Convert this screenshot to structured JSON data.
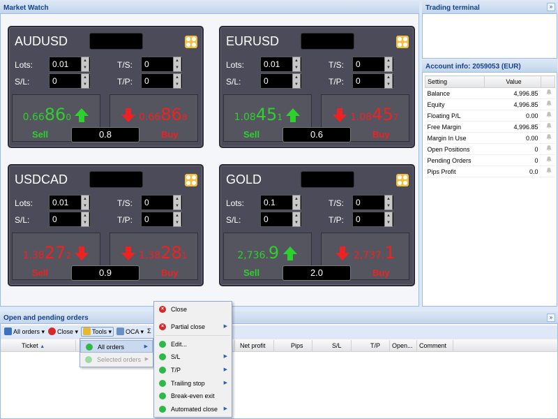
{
  "market_watch": {
    "title": "Market Watch",
    "cards": [
      {
        "symbol": "AUDUSD",
        "lots": "0.01",
        "ts": "0",
        "sl": "0",
        "tp": "0",
        "sell": {
          "pre": "0.66",
          "big": "86",
          "sm": "0",
          "dir": "up"
        },
        "buy": {
          "pre": "0.66",
          "big": "86",
          "sm": "8",
          "dir": "down"
        },
        "spread": "0.8",
        "sell_label": "Sell",
        "buy_label": "Buy",
        "label_color": "green"
      },
      {
        "symbol": "EURUSD",
        "lots": "0.01",
        "ts": "0",
        "sl": "0",
        "tp": "0",
        "sell": {
          "pre": "1.08",
          "big": "45",
          "sm": "1",
          "dir": "up"
        },
        "buy": {
          "pre": "1.08",
          "big": "45",
          "sm": "7",
          "dir": "down"
        },
        "spread": "0.6",
        "sell_label": "Sell",
        "buy_label": "Buy",
        "label_color": "green"
      },
      {
        "symbol": "USDCAD",
        "lots": "0.01",
        "ts": "0",
        "sl": "0",
        "tp": "0",
        "sell": {
          "pre": "1.38",
          "big": "27",
          "sm": "2",
          "dir": "down"
        },
        "buy": {
          "pre": "1.38",
          "big": "28",
          "sm": "1",
          "dir": "down"
        },
        "spread": "0.9",
        "sell_label": "Sell",
        "buy_label": "Buy",
        "label_color": "red"
      },
      {
        "symbol": "GOLD",
        "lots": "0.1",
        "ts": "0",
        "sl": "0",
        "tp": "0",
        "sell": {
          "pre": "2,736.",
          "big": "9",
          "sm": "",
          "dir": "up"
        },
        "buy": {
          "pre": "2,737.",
          "big": "1",
          "sm": "",
          "dir": "down"
        },
        "spread": "2.0",
        "sell_label": "Sell",
        "buy_label": "Buy",
        "label_color": "mixed"
      }
    ],
    "labels": {
      "lots": "Lots:",
      "ts": "T/S:",
      "sl": "S/L:",
      "tp": "T/P:"
    }
  },
  "trading_terminal": {
    "title": "Trading terminal"
  },
  "account": {
    "title": "Account info: 2059053 (EUR)",
    "col_setting": "Setting",
    "col_value": "Value",
    "rows": [
      {
        "setting": "Balance",
        "value": "4,996.85"
      },
      {
        "setting": "Equity",
        "value": "4,996.85"
      },
      {
        "setting": "Floating P/L",
        "value": "0.00"
      },
      {
        "setting": "Free Margin",
        "value": "4,996.85"
      },
      {
        "setting": "Margin In Use",
        "value": "0.00"
      },
      {
        "setting": "Open Positions",
        "value": "0"
      },
      {
        "setting": "Pending Orders",
        "value": "0"
      },
      {
        "setting": "Pips Profit",
        "value": "0.0"
      }
    ]
  },
  "orders": {
    "title": "Open and pending orders",
    "toolbar": {
      "all_orders": "All orders",
      "close": "Close",
      "tools": "Tools",
      "oca": "OCA",
      "sigma": "Σ"
    },
    "columns": {
      "ticket": "Ticket",
      "net_profit": "Net profit",
      "pips": "Pips",
      "sl": "S/L",
      "tp": "T/P",
      "open": "Open...",
      "comment": "Comment"
    }
  },
  "tools_menu": {
    "items": [
      {
        "label": "All orders"
      },
      {
        "label": "Selected orders"
      }
    ]
  },
  "context_menu": {
    "items": [
      {
        "label": "Close"
      },
      {
        "label": "Partial close"
      },
      {
        "label": "Edit..."
      },
      {
        "label": "S/L"
      },
      {
        "label": "T/P"
      },
      {
        "label": "Trailing stop"
      },
      {
        "label": "Break-even exit"
      },
      {
        "label": "Automated close"
      }
    ]
  },
  "colors": {
    "up": "#2ed02e",
    "down": "#ee2222",
    "panel_header": "#15428b",
    "card_bg": "#4b4b5a"
  }
}
